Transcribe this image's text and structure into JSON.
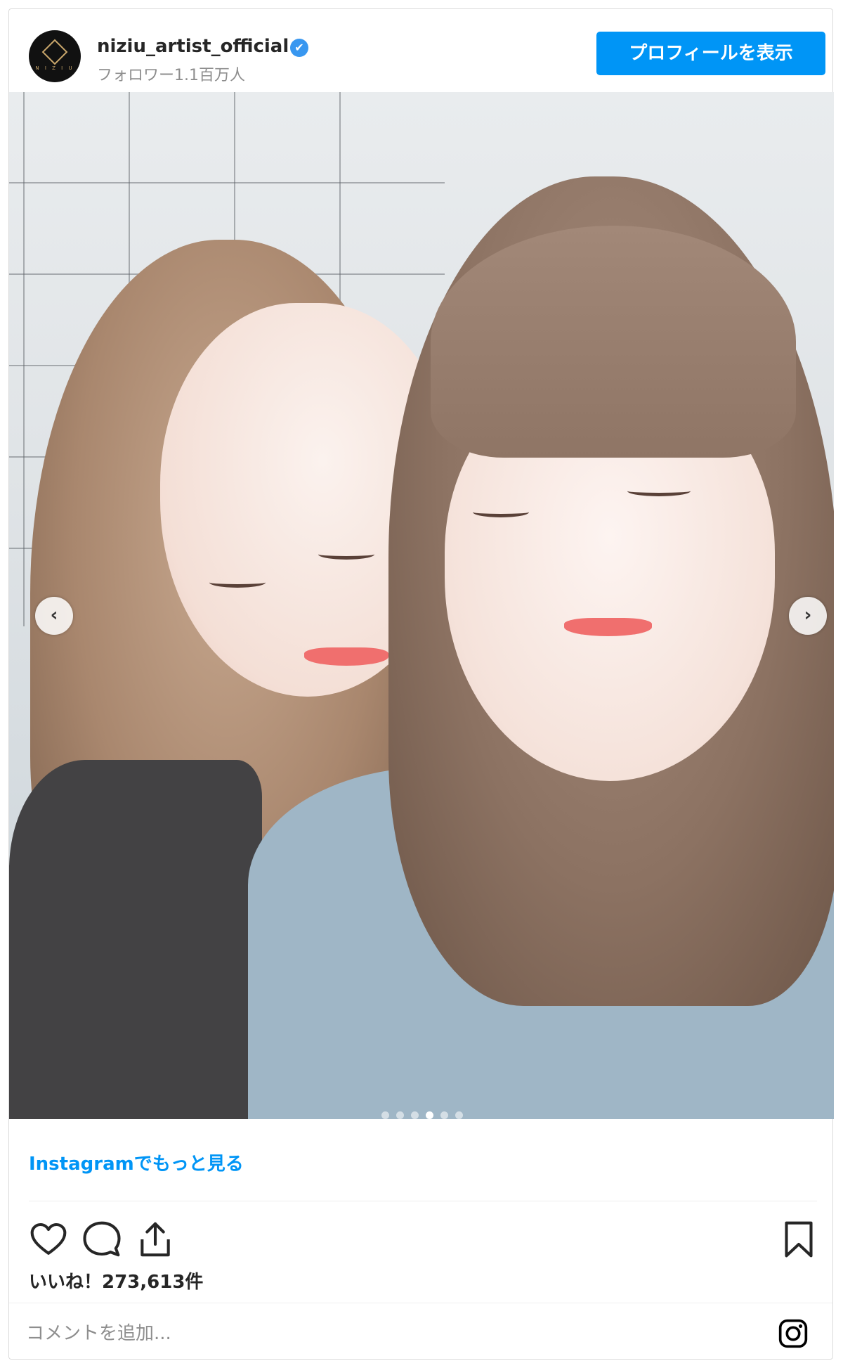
{
  "header": {
    "username": "niziu_artist_official",
    "verified_icon": "✔",
    "followers": "フォロワー1.1百万人",
    "profile_button": "プロフィールを表示",
    "avatar_logo_text": "N I Z I U"
  },
  "media": {
    "prev_arrow": "‹",
    "next_arrow": "›",
    "carousel_total": 6,
    "carousel_active_index": 3
  },
  "footer": {
    "more_link": "Instagramでもっと見る",
    "likes": "いいね！273,613件",
    "comment_placeholder": "コメントを追加..."
  },
  "icons": [
    "heart-icon",
    "comment-icon",
    "share-icon",
    "bookmark-icon",
    "instagram-icon",
    "verified-badge-icon"
  ],
  "colors": {
    "accent": "#0095f6",
    "verified": "#3897f0",
    "text": "#262626",
    "muted": "#8e8e8e",
    "border": "#dbdbdb"
  }
}
